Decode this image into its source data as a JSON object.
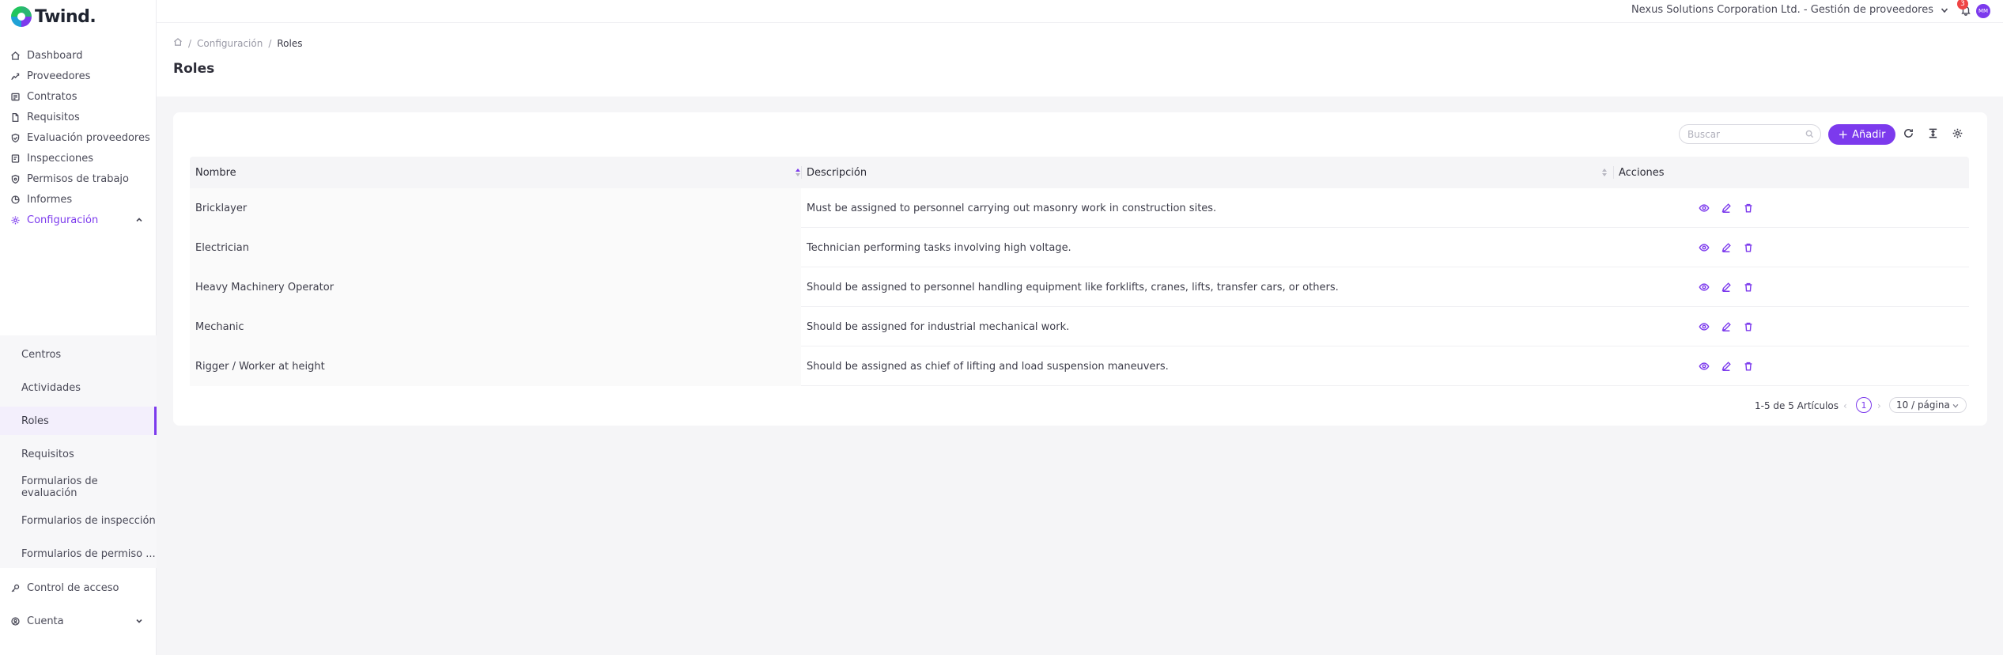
{
  "app": {
    "brand": "Twind."
  },
  "topbar": {
    "organization": "Nexus Solutions Corporation Ltd. - Gestión de proveedores",
    "notification_count": "3",
    "avatar_initials": "MM"
  },
  "sidebar": {
    "items": [
      {
        "label": "Dashboard",
        "icon": "home-icon"
      },
      {
        "label": "Proveedores",
        "icon": "handshake-icon"
      },
      {
        "label": "Contratos",
        "icon": "contract-icon"
      },
      {
        "label": "Requisitos",
        "icon": "document-icon"
      },
      {
        "label": "Evaluación proveedores",
        "icon": "shield-check-icon"
      },
      {
        "label": "Inspecciones",
        "icon": "inspection-icon"
      },
      {
        "label": "Permisos de trabajo",
        "icon": "permit-shield-icon"
      },
      {
        "label": "Informes",
        "icon": "pie-chart-icon"
      },
      {
        "label": "Configuración",
        "icon": "gear-icon"
      },
      {
        "label": "Control de acceso",
        "icon": "key-icon"
      },
      {
        "label": "Cuenta",
        "icon": "user-circle-icon"
      }
    ],
    "config_subitems": [
      {
        "label": "Centros"
      },
      {
        "label": "Actividades"
      },
      {
        "label": "Roles"
      },
      {
        "label": "Requisitos"
      },
      {
        "label": "Formularios de evaluación"
      },
      {
        "label": "Formularios de inspección"
      },
      {
        "label": "Formularios de permiso ..."
      }
    ],
    "active_subitem": "Roles"
  },
  "breadcrumb": {
    "parent": "Configuración",
    "current": "Roles"
  },
  "page": {
    "title": "Roles"
  },
  "toolbar": {
    "search_placeholder": "Buscar",
    "add_label": "Añadir"
  },
  "table": {
    "columns": [
      "Nombre",
      "Descripción",
      "Acciones"
    ],
    "rows": [
      {
        "name": "Bricklayer",
        "description": "Must be assigned to personnel carrying out masonry work in construction sites."
      },
      {
        "name": "Electrician",
        "description": "Technician performing tasks involving high voltage."
      },
      {
        "name": "Heavy Machinery Operator",
        "description": "Should be assigned to personnel handling equipment like forklifts, cranes, lifts, transfer cars, or others."
      },
      {
        "name": "Mechanic",
        "description": "Should be assigned for industrial mechanical work."
      },
      {
        "name": "Rigger / Worker at height",
        "description": "Should be assigned as chief of lifting and load suspension maneuvers."
      }
    ]
  },
  "pagination": {
    "total_text": "1-5 de 5 Artículos",
    "current_page": "1",
    "page_size": "10 / página"
  },
  "colors": {
    "accent": "#7c3aed",
    "badge": "#ef4444"
  }
}
